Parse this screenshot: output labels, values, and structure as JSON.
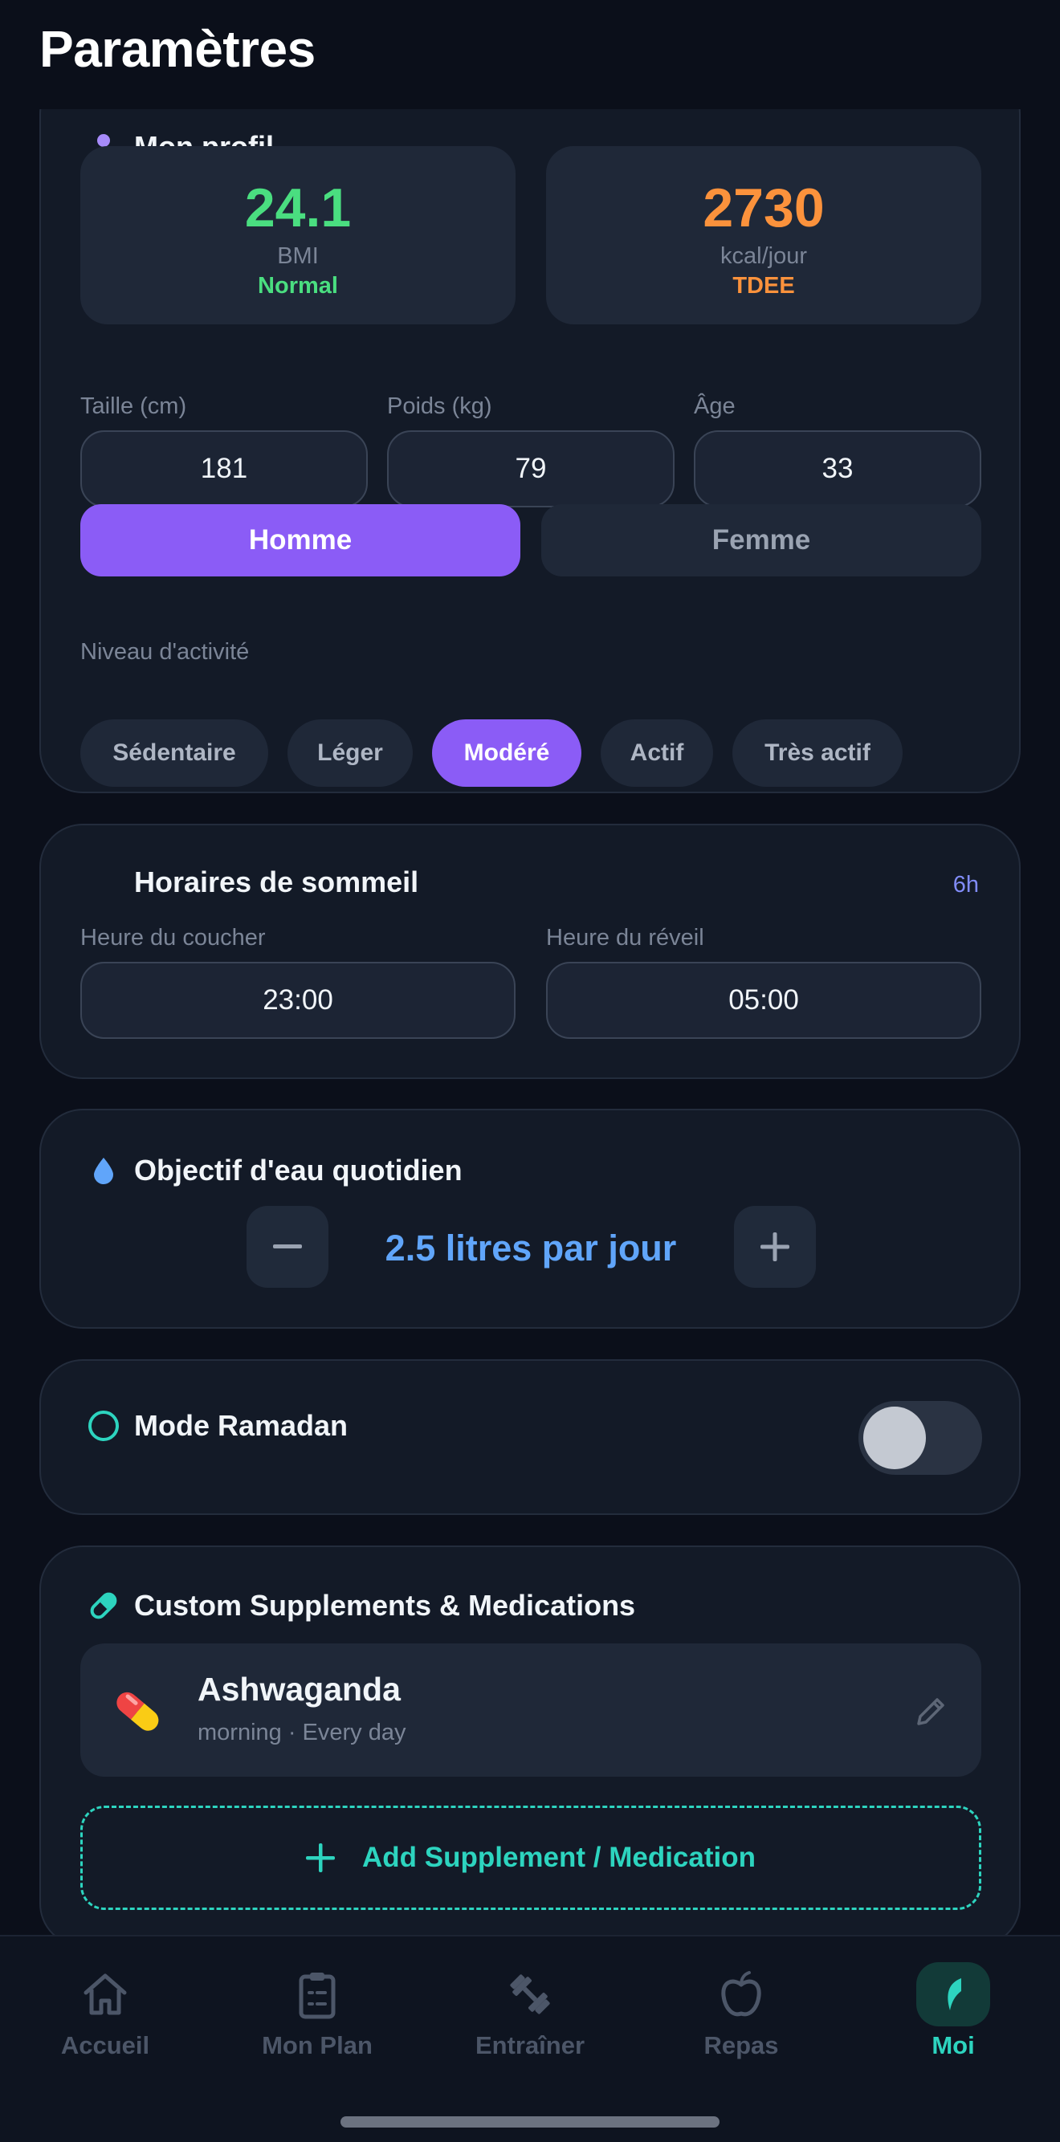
{
  "header": {
    "title": "Paramètres"
  },
  "profile": {
    "title": "Mon profil",
    "icon": "person-icon",
    "bmi": {
      "value": "24.1",
      "unit": "BMI",
      "status": "Normal",
      "color": "#4ade80"
    },
    "tdee": {
      "value": "2730",
      "unit": "kcal/jour",
      "status": "TDEE",
      "color": "#fb923c"
    },
    "height": {
      "label": "Taille (cm)",
      "value": "181"
    },
    "weight": {
      "label": "Poids (kg)",
      "value": "79"
    },
    "age": {
      "label": "Âge",
      "value": "33"
    },
    "gender": {
      "options": [
        "Homme",
        "Femme"
      ],
      "selected": "Homme"
    },
    "activity": {
      "label": "Niveau d'activité",
      "options": [
        "Sédentaire",
        "Léger",
        "Modéré",
        "Actif",
        "Très actif"
      ],
      "selected": "Modéré"
    }
  },
  "sleep": {
    "title": "Horaires de sommeil",
    "icon": "moon-icon",
    "duration": "6h",
    "bedtime": {
      "label": "Heure du coucher",
      "value": "23:00"
    },
    "wake": {
      "label": "Heure du réveil",
      "value": "05:00"
    }
  },
  "water": {
    "title": "Objectif d'eau quotidien",
    "icon": "water-drop-icon",
    "value": "2.5 litres par jour",
    "color": "#60a5fa"
  },
  "ramadan": {
    "title": "Mode Ramadan",
    "icon": "circle-icon",
    "enabled": false
  },
  "supplements": {
    "title": "Custom Supplements & Medications",
    "icon": "pill-icon",
    "items": [
      {
        "name": "Ashwaganda",
        "schedule": "morning · Every day",
        "icon": "capsule-icon"
      }
    ],
    "add_label": "Add Supplement / Medication"
  },
  "tabs": [
    {
      "label": "Accueil",
      "icon": "home-icon",
      "active": false
    },
    {
      "label": "Mon Plan",
      "icon": "clipboard-icon",
      "active": false
    },
    {
      "label": "Entraîner",
      "icon": "dumbbell-icon",
      "active": false
    },
    {
      "label": "Repas",
      "icon": "apple-icon",
      "active": false
    },
    {
      "label": "Moi",
      "icon": "leaf-icon",
      "active": true
    }
  ],
  "colors": {
    "accent": "#8b5cf6",
    "teal": "#2dd4bf",
    "background": "#0b0f1a",
    "card": "#131a27"
  }
}
